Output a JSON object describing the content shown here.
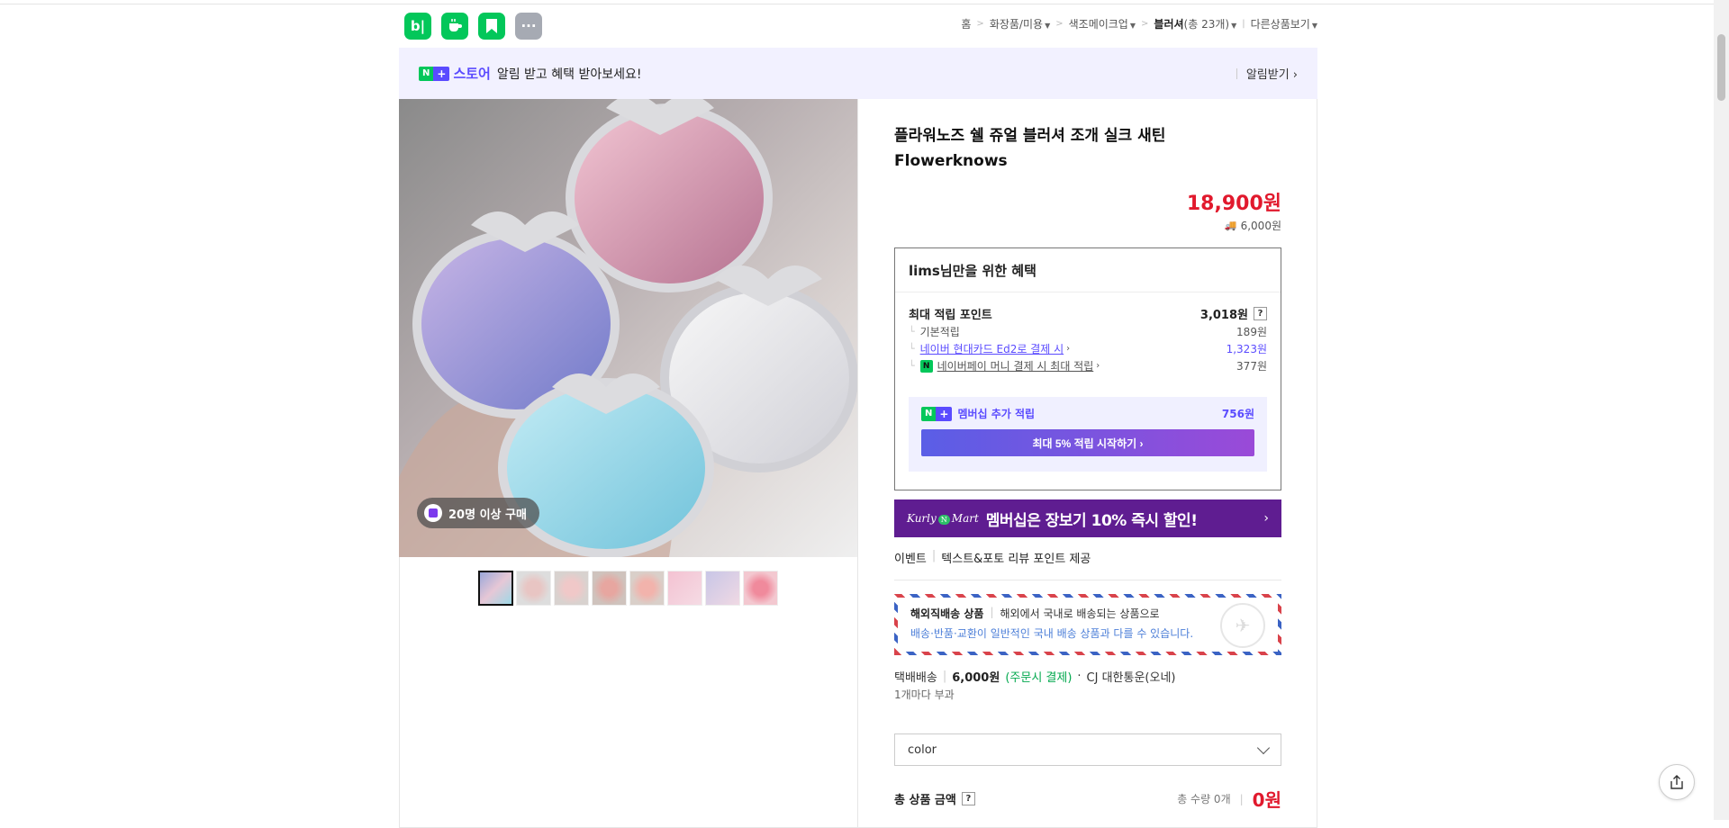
{
  "header": {
    "app_icons": [
      {
        "label": "b|",
        "icon": "blog-icon"
      },
      {
        "label": "",
        "icon": "cafe-icon"
      },
      {
        "label": "",
        "icon": "bookmark-icon"
      },
      {
        "label": "···",
        "icon": "more-icon"
      }
    ],
    "breadcrumb": {
      "home": "홈",
      "cat1": "화장품/미용",
      "cat2": "색조메이크업",
      "cat3": "블러셔",
      "cat3_count": "(총 23개)",
      "other": "다른상품보기"
    }
  },
  "notice": {
    "badge_n": "N",
    "badge_plus": "+",
    "store": "스토어",
    "text": "알림 받고 혜택 받아보세요!",
    "action": "알림받기 ›"
  },
  "gallery": {
    "buy_badge": "20명 이상 구매",
    "thumb_count": 8
  },
  "product": {
    "title": "플라워노즈 쉘 쥬얼 블러셔 조개 실크 새틴 Flowerknows",
    "price": "18,900원",
    "shipping_fee": "6,000원"
  },
  "benefit": {
    "heading": "lims님만을 위한 혜택",
    "max_points_label": "최대 적립 포인트",
    "max_points_value": "3,018원",
    "basic_label": "기본적립",
    "basic_value": "189원",
    "card_label": "네이버 현대카드 Ed2로 결제 시",
    "card_value": "1,323원",
    "npay_label": "네이버페이 머니 결제 시 최대 적립",
    "npay_value": "377원",
    "member_label": "멤버십 추가 적립",
    "member_value": "756원",
    "member_button": "최대 5% 적립 시작하기 ›"
  },
  "kurly": {
    "logo": "Kurly",
    "logo_m": "N",
    "logo_mart": "Mart",
    "text": "멤버십은 장보기 10% 즉시 할인!",
    "arrow": "›"
  },
  "event": {
    "label": "이벤트",
    "text": "텍스트&포토 리뷰 포인트 제공"
  },
  "overseas": {
    "title": "해외직배송 상품",
    "line1": "해외에서 국내로 배송되는 상품으로",
    "line2": "배송·반품·교환이 일반적인 국내 배송 상품과 다를 수 있습니다."
  },
  "delivery": {
    "type": "택배배송",
    "fee": "6,000원",
    "note": "(주문시 결제)",
    "carrier": "CJ 대한통운(오네)",
    "per_item": "1개마다 부과"
  },
  "option": {
    "selected": "color"
  },
  "total": {
    "label": "총 상품 금액",
    "qty": "총 수량 0개",
    "sum": "0원"
  },
  "colors": {
    "naver_green": "#03c75a",
    "price_red": "#e1192d",
    "store_purple": "#5a4bff",
    "kurly_purple": "#5f1d91"
  }
}
